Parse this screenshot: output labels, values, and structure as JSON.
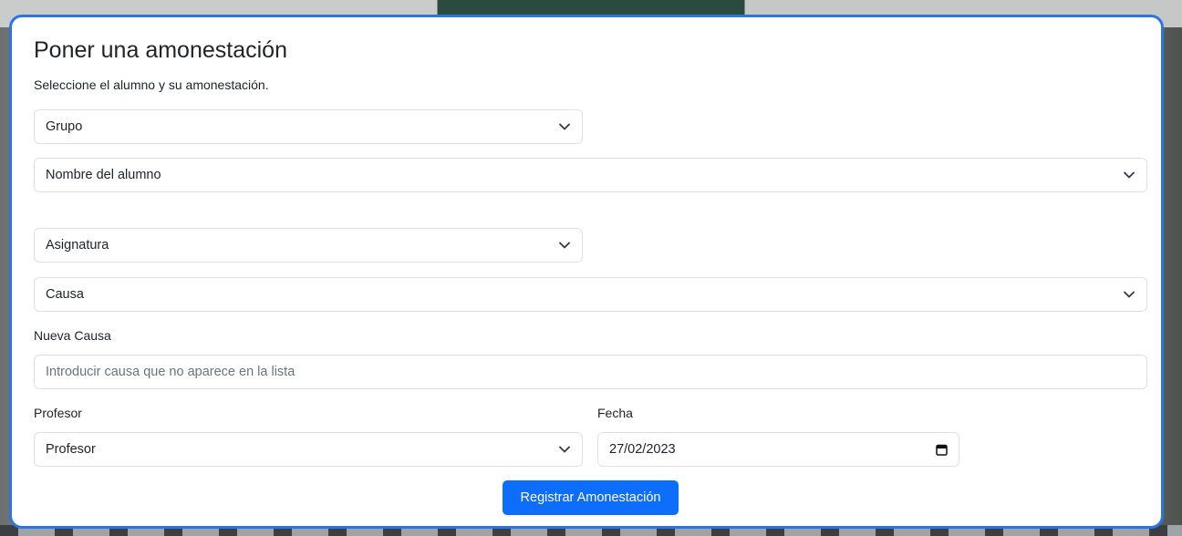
{
  "form": {
    "title": "Poner una amonestación",
    "subtitle": "Seleccione el alumno y su amonestación.",
    "grupo": "Grupo",
    "alumno": "Nombre del alumno",
    "asignatura": "Asignatura",
    "causa": "Causa",
    "nueva_causa_label": "Nueva Causa",
    "nueva_causa_placeholder": "Introducir causa que no aparece en la lista",
    "profesor_label": "Profesor",
    "profesor_value": "Profesor",
    "fecha_label": "Fecha",
    "fecha_value": "27/02/2023",
    "submit_label": "Registrar Amonestación"
  },
  "icons": {
    "select_arrow": "chevron-down-icon",
    "date_picker": "calendar-icon"
  },
  "colors": {
    "accent": "#0d6efd",
    "card_border": "#2a74e6"
  }
}
